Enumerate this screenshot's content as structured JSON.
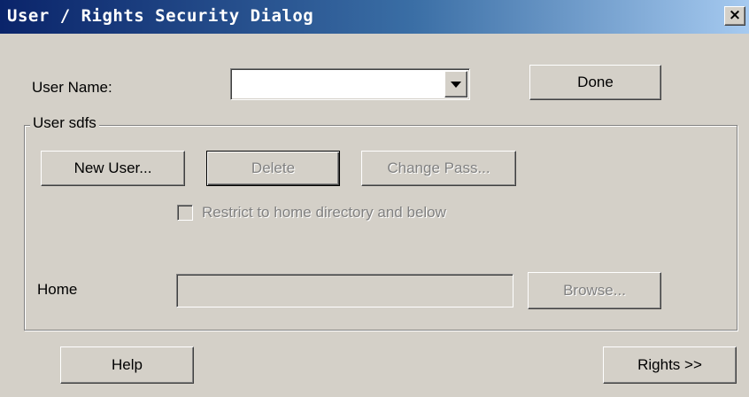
{
  "window": {
    "title": "User / Rights Security Dialog",
    "close_label": "×"
  },
  "user_name": {
    "label": "User Name:",
    "value": ""
  },
  "buttons": {
    "done": "Done",
    "new_user": "New User...",
    "delete": "Delete",
    "change_pass": "Change Pass...",
    "browse": "Browse...",
    "help": "Help",
    "rights": "Rights >>"
  },
  "group": {
    "legend": "User sdfs"
  },
  "restrict": {
    "label": "Restrict to home directory and below",
    "checked": false,
    "enabled": false
  },
  "home": {
    "label": "Home",
    "value": ""
  },
  "colors": {
    "dialog_bg": "#d4d0c8",
    "title_start": "#0a246a",
    "title_end": "#a6caf0",
    "disabled_text": "#808080"
  }
}
